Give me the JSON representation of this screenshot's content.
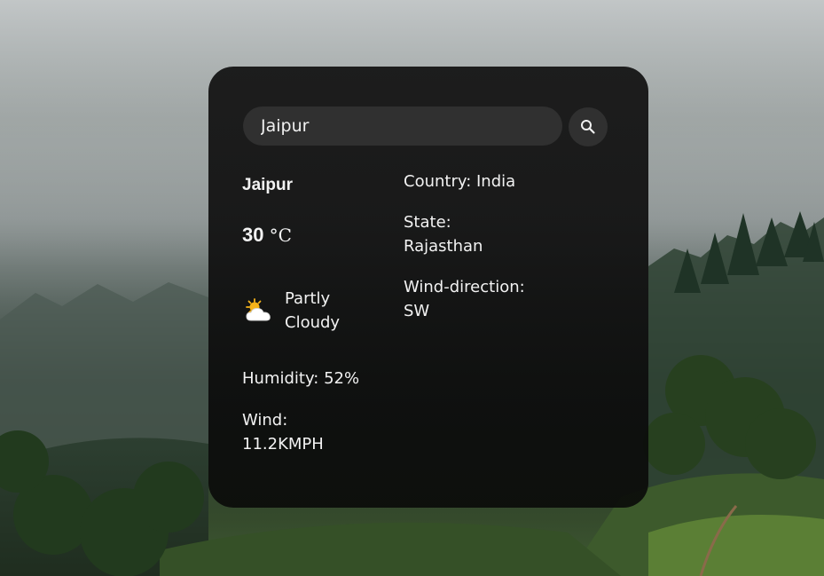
{
  "search": {
    "value": "Jaipur"
  },
  "weather": {
    "city": "Jaipur",
    "temperature": "30",
    "unit": "°C",
    "condition": "Partly Cloudy",
    "condition_icon": "partly-cloudy-icon",
    "humidity": "Humidity: 52%",
    "wind_label": "Wind:",
    "wind_value": "11.2KMPH",
    "country": "Country: India",
    "state_label": "State:",
    "state_value": "Rajasthan",
    "wind_direction_label": "Wind-direction:",
    "wind_direction_value": "SW"
  },
  "colors": {
    "card_background": "#181818",
    "input_background": "#303030",
    "text": "#f2f2f2",
    "sun": "#f6b31a"
  }
}
